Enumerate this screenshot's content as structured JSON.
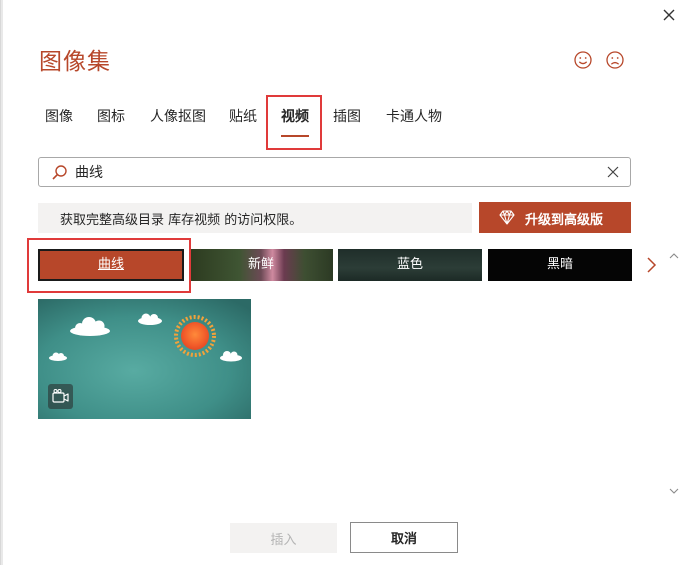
{
  "dialog": {
    "title": "图像集"
  },
  "tabs": [
    {
      "label": "图像"
    },
    {
      "label": "图标"
    },
    {
      "label": "人像抠图"
    },
    {
      "label": "贴纸"
    },
    {
      "label": "视频",
      "selected": true
    },
    {
      "label": "插图"
    },
    {
      "label": "卡通人物"
    }
  ],
  "search": {
    "value": "曲线"
  },
  "banner": {
    "text": "获取完整高级目录 库存视频 的访问权限。",
    "upgrade_label": "升级到高级版"
  },
  "categories": [
    {
      "label": "曲线",
      "selected": true
    },
    {
      "label": "新鲜"
    },
    {
      "label": "蓝色"
    },
    {
      "label": "黑暗"
    }
  ],
  "footer": {
    "insert_label": "插入",
    "cancel_label": "取消"
  },
  "colors": {
    "accent": "#b7472a",
    "highlight_box": "#e03a3a",
    "thumbnail_bg": "#3f8f88"
  }
}
